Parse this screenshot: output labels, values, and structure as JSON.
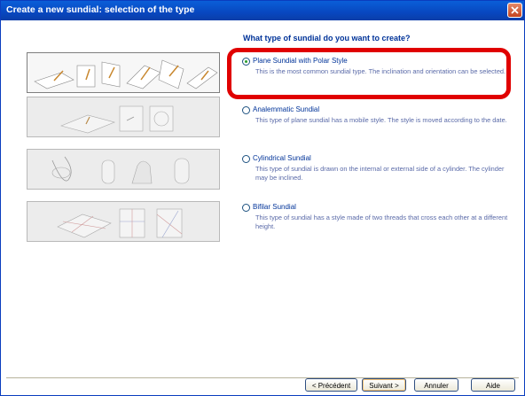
{
  "window": {
    "title": "Create a new sundial: selection of the type",
    "close_icon": "close-icon"
  },
  "question": "What type of sundial do you want to create?",
  "options": [
    {
      "label": "Plane Sundial with Polar Style",
      "description": "This is the most common sundial type. The inclination and orientation can be selected.",
      "checked": true
    },
    {
      "label": "Analemmatic Sundial",
      "description": "This type of plane sundial has a mobile style. The style is moved according to the date.",
      "checked": false
    },
    {
      "label": "Cylindrical Sundial",
      "description": "This type of sundial is drawn on the internal or external side of a cylinder. The cylinder may be inclined.",
      "checked": false
    },
    {
      "label": "Bifilar Sundial",
      "description": "This type of sundial has a style made of two threads that cross each other at a different height.",
      "checked": false
    }
  ],
  "buttons": {
    "previous": "< Précédent",
    "next": "Suivant >",
    "cancel": "Annuler",
    "help": "Aide"
  },
  "colors": {
    "title_bar": "#0a5fd8",
    "highlight": "#e00000",
    "label_text": "#003399"
  }
}
